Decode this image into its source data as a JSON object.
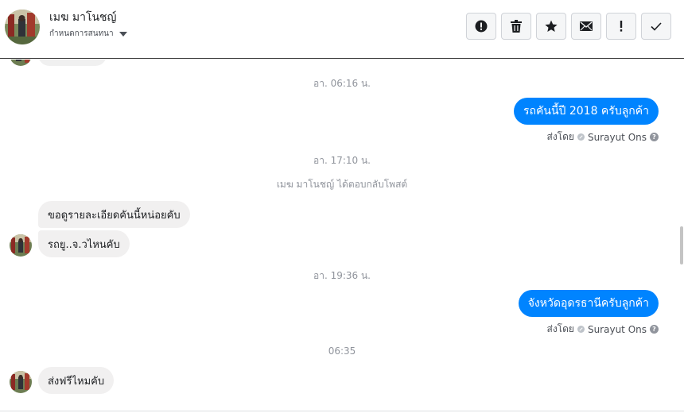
{
  "header": {
    "contact_name": "เมฆ มาโนชญ์",
    "subtitle": "กำหนดการสนทนา",
    "subtitle_icon": "caret-down-icon",
    "tools": [
      {
        "name": "report-button",
        "icon": "alert-circle-icon"
      },
      {
        "name": "delete-button",
        "icon": "trash-icon"
      },
      {
        "name": "star-button",
        "icon": "star-icon"
      },
      {
        "name": "mark-unread-button",
        "icon": "envelope-icon"
      },
      {
        "name": "spam-button",
        "icon": "exclamation-icon"
      },
      {
        "name": "done-button",
        "icon": "checkmark-icon"
      }
    ]
  },
  "thread": {
    "stamp_1": "อา. 06:16 น.",
    "out_1": "รถคันนี้ปี 2018 ครับลูกค้า",
    "sent_by_label_1": "ส่งโดย",
    "sent_by_name_1": "Surayut Ons",
    "stamp_2": "อา. 17:10 น.",
    "system_1": "เมฆ มาโนชญ์ ได้ตอบกลับโพสต์",
    "in_1": "ขอดูรายละเอียดคันนี้หน่อยคับ",
    "in_2": "รถยู..จ.วไหนคับ",
    "stamp_3": "อา. 19:36 น.",
    "out_2": "จังหวัดอุดรธานีครับลูกค้า",
    "sent_by_label_2": "ส่งโดย",
    "sent_by_name_2": "Surayut Ons",
    "stamp_4": "06:35",
    "in_3": "ส่งฟรีไหมคับ"
  },
  "colors": {
    "outgoing_bubble": "#0084ff",
    "incoming_bubble": "#f1f0f0",
    "meta_text": "#90949c"
  }
}
